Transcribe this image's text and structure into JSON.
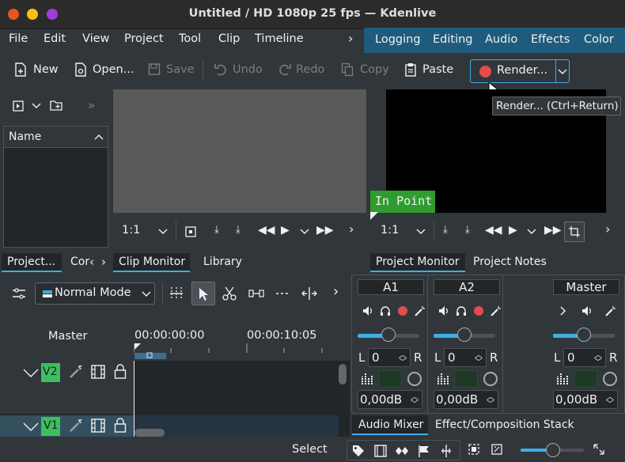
{
  "window": {
    "title": "Untitled / HD 1080p 25 fps — Kdenlive"
  },
  "menu": {
    "items": [
      "File",
      "Edit",
      "View",
      "Project",
      "Tool",
      "Clip",
      "Timeline"
    ],
    "more": "›"
  },
  "workspaces": [
    "Logging",
    "Editing",
    "Audio",
    "Effects",
    "Color"
  ],
  "toolbar": {
    "new": "New",
    "open": "Open...",
    "save": "Save",
    "undo": "Undo",
    "redo": "Redo",
    "copy": "Copy",
    "paste": "Paste",
    "render": "Render...",
    "tooltip": "Render... (Ctrl+Return)"
  },
  "bin": {
    "header": "Name",
    "tab_project": "Project...",
    "tab_second": "Cor"
  },
  "clip_monitor": {
    "zoom": "1:1",
    "tab": "Clip Monitor",
    "tab2": "Library"
  },
  "project_monitor": {
    "zoom": "1:1",
    "in_point": "In Point",
    "tab": "Project Monitor",
    "tab2": "Project Notes"
  },
  "timeline": {
    "mode": "Normal Mode",
    "master": "Master",
    "tc_start": "00:00:00:00",
    "tc_next": "00:00:10:05",
    "tracks": [
      {
        "name": "V2"
      },
      {
        "name": "V1"
      }
    ]
  },
  "mixer": {
    "channels": [
      {
        "name": "A1",
        "lr": "L",
        "val": "0",
        "r": "R",
        "db": "0,00dB"
      },
      {
        "name": "A2",
        "lr": "L",
        "val": "0",
        "r": "R",
        "db": "0,00dB"
      },
      {
        "name": "Master",
        "lr": "L",
        "val": "0",
        "r": "R",
        "db": "0,00dB"
      }
    ],
    "tab": "Audio Mixer",
    "tab2": "Effect/Composition Stack"
  },
  "status": {
    "select": "Select"
  },
  "colors": {
    "accent": "#1e5b7d",
    "in_point": "#2f9c2f",
    "render_dot": "#e24c4c",
    "track_label": "#3bbf5f"
  }
}
